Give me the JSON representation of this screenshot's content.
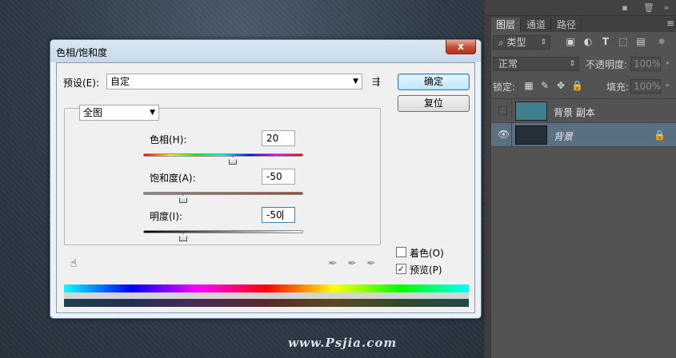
{
  "dialog": {
    "title": "色相/饱和度",
    "close_label": "x",
    "preset_label": "预设(E):",
    "preset_value": "自定",
    "ok_label": "确定",
    "reset_label": "复位",
    "channel_value": "全图",
    "hue": {
      "label": "色相(H):",
      "value": "20",
      "level": 0.56
    },
    "saturation": {
      "label": "饱和度(A):",
      "value": "-50",
      "level": 0.25
    },
    "lightness": {
      "label": "明度(I):",
      "value": "-50",
      "level": 0.25
    },
    "colorize_label": "着色(O)",
    "colorize_checked": false,
    "preview_label": "预览(P)",
    "preview_checked": true,
    "check_mark": "✓"
  },
  "panel": {
    "tabs": [
      "图层",
      "通道",
      "路径"
    ],
    "filter_value": "类型",
    "blend_mode": "正常",
    "opacity_label": "不透明度:",
    "opacity_value": "100%",
    "lock_label": "锁定:",
    "fill_label": "填充:",
    "fill_value": "100%",
    "layers": [
      {
        "name": "背景 副本",
        "visible": false,
        "selected": false,
        "thumb_color": "#3f7f90"
      },
      {
        "name": "背景",
        "visible": true,
        "selected": true,
        "thumb_color": "#26303b"
      }
    ]
  },
  "watermark": "www.Psjia.com",
  "colors": {
    "dialog_bg": "#f0f0f0",
    "selected_layer": "#5b6f82",
    "panel_bg": "#535353"
  }
}
